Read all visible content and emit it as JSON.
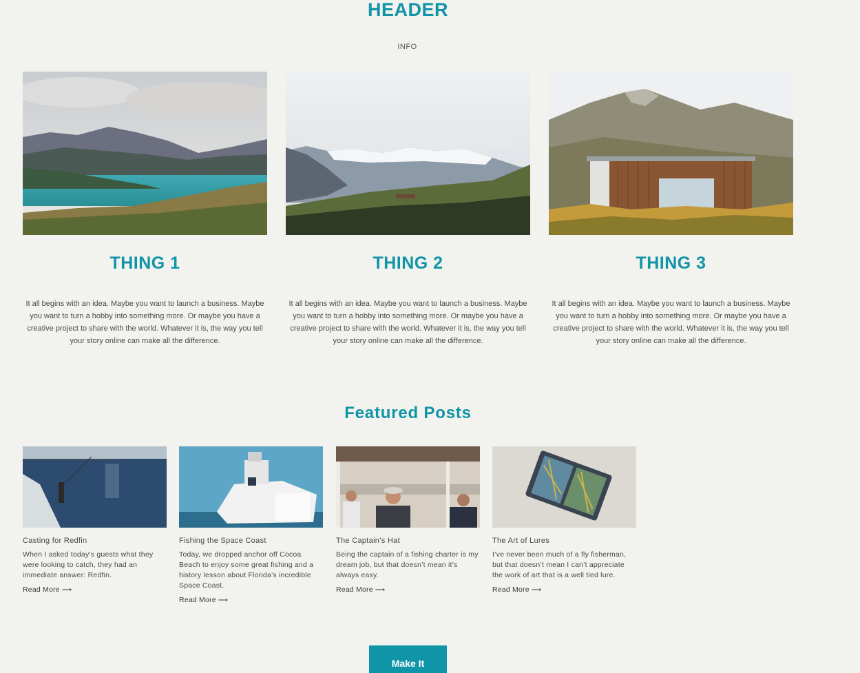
{
  "header": {
    "title": "HEADER",
    "info": "INFO"
  },
  "things": [
    {
      "title": "THING 1",
      "body": "It all begins with an idea. Maybe you want to launch a business. Maybe you want to turn a hobby into something more. Or maybe you have a creative project to share with the world. Whatever it is, the way you tell your story online can make all the difference."
    },
    {
      "title": "THING 2",
      "body": "It all begins with an idea. Maybe you want to launch a business. Maybe you want to turn a hobby into something more. Or maybe you have a creative project to share with the world. Whatever it is, the way you tell your story online can make all the difference."
    },
    {
      "title": "THING 3",
      "body": "It all begins with an idea. Maybe you want to launch a business. Maybe you want to turn a hobby into something more. Or maybe you have a creative project to share with the world. Whatever it is, the way you tell your story online can make all the difference."
    }
  ],
  "featured": {
    "title": "Featured Posts",
    "read_more": "Read More",
    "posts": [
      {
        "title": "Casting for Redfin",
        "excerpt": "When I asked today’s guests what they were looking to catch, they had an immediate answer: Redfin."
      },
      {
        "title": "Fishing the Space Coast",
        "excerpt": "Today, we dropped anchor off Cocoa Beach to enjoy some great fishing and a history lesson about Florida’s incredible Space Coast."
      },
      {
        "title": "The Captain’s Hat",
        "excerpt": "Being the captain of a fishing charter is my dream job, but that doesn’t mean it’s always easy."
      },
      {
        "title": "The Art of Lures",
        "excerpt": "I’ve never been much of a fly fisherman, but that doesn’t mean I can’t appreciate the work of art that is a well tied lure."
      }
    ]
  },
  "cta": {
    "label": "Make It"
  },
  "colors": {
    "accent": "#0f94a8",
    "background": "#f2f2ee"
  }
}
